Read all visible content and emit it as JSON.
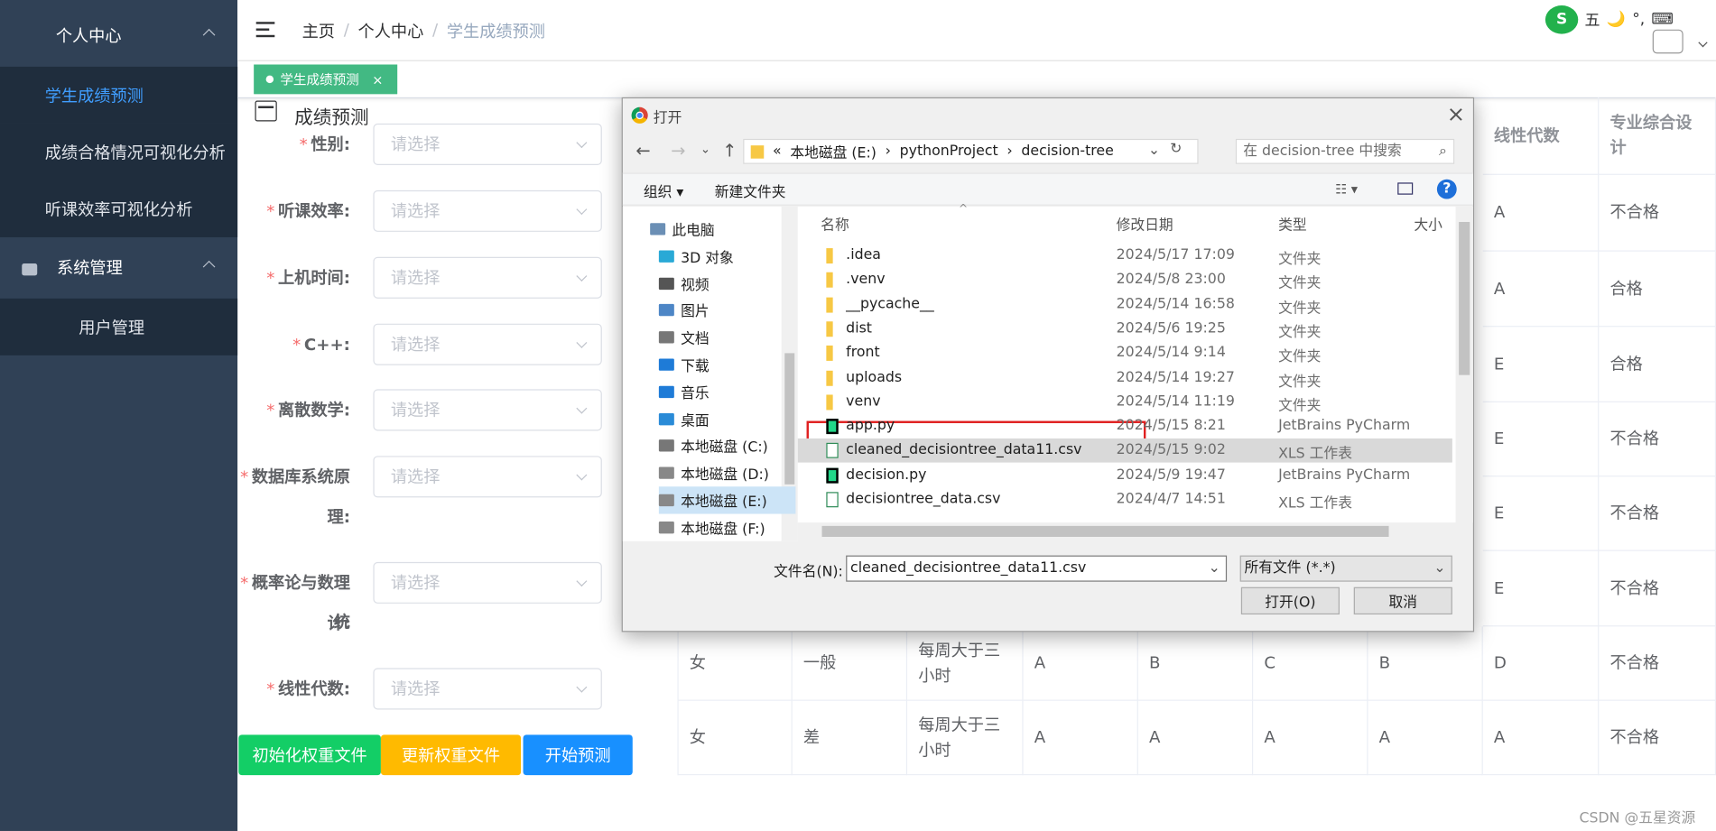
{
  "sidebar": {
    "group1": "个人中心",
    "items": [
      "学生成绩预测",
      "成绩合格情况可视化分析",
      "听课效率可视化分析"
    ],
    "group2": "系统管理",
    "sub": "用户管理"
  },
  "header": {
    "crumbs": [
      "主页",
      "个人中心",
      "学生成绩预测"
    ],
    "tag": "学生成绩预测",
    "tag_close": "×"
  },
  "form": {
    "title": "成绩预测",
    "fields": [
      {
        "l1": "性别:",
        "l2": ""
      },
      {
        "l1": "听课效率:",
        "l2": ""
      },
      {
        "l1": "上机时间:",
        "l2": ""
      },
      {
        "l1": "C++:",
        "l2": ""
      },
      {
        "l1": "离散数学:",
        "l2": ""
      },
      {
        "l1": "数据库系统原",
        "l2": "理:"
      },
      {
        "l1": "概率论与数理统",
        "l2": "计:"
      },
      {
        "l1": "线性代数:",
        "l2": ""
      }
    ],
    "placeholder": "请选择",
    "req": "*",
    "buttons": [
      "初始化权重文件",
      "更新权重文件",
      "开始预测"
    ]
  },
  "table": {
    "headers": [
      "线性代数",
      "专业综合设计"
    ],
    "right_rows": [
      [
        "A",
        "不合格"
      ],
      [
        "A",
        "合格"
      ],
      [
        "E",
        "合格"
      ],
      [
        "E",
        "不合格"
      ],
      [
        "E",
        "不合格"
      ],
      [
        "E",
        "不合格"
      ]
    ],
    "full_rows": [
      [
        "女",
        "一般",
        "每周大于三小时",
        "A",
        "B",
        "C",
        "B",
        "D",
        "不合格"
      ],
      [
        "女",
        "差",
        "每周大于三小时",
        "A",
        "A",
        "A",
        "A",
        "A",
        "不合格"
      ]
    ]
  },
  "dialog": {
    "title": "打开",
    "close": "×",
    "path": [
      "«",
      "本地磁盘 (E:)",
      "›",
      "pythonProject",
      "›",
      "decision-tree"
    ],
    "search_placeholder": "在 decision-tree 中搜索",
    "organize": "组织 ▾",
    "new_folder": "新建文件夹",
    "nav": [
      "此电脑",
      "3D 对象",
      "视频",
      "图片",
      "文档",
      "下载",
      "音乐",
      "桌面",
      "本地磁盘 (C:)",
      "本地磁盘 (D:)",
      "本地磁盘 (E:)",
      "本地磁盘 (F:)"
    ],
    "cols": [
      "名称",
      "修改日期",
      "类型",
      "大小"
    ],
    "files": [
      {
        "name": ".idea",
        "date": "2024/5/17 17:09",
        "type": "文件夹",
        "kind": "folder"
      },
      {
        "name": ".venv",
        "date": "2024/5/8 23:00",
        "type": "文件夹",
        "kind": "folder"
      },
      {
        "name": "__pycache__",
        "date": "2024/5/14 16:58",
        "type": "文件夹",
        "kind": "folder"
      },
      {
        "name": "dist",
        "date": "2024/5/6 19:25",
        "type": "文件夹",
        "kind": "folder"
      },
      {
        "name": "front",
        "date": "2024/5/14 9:14",
        "type": "文件夹",
        "kind": "folder"
      },
      {
        "name": "uploads",
        "date": "2024/5/14 19:27",
        "type": "文件夹",
        "kind": "folder"
      },
      {
        "name": "venv",
        "date": "2024/5/14 11:19",
        "type": "文件夹",
        "kind": "folder"
      },
      {
        "name": "app.py",
        "date": "2024/5/15 8:21",
        "type": "JetBrains PyCharm",
        "kind": "py"
      },
      {
        "name": "cleaned_decisiontree_data11.csv",
        "date": "2024/5/15 9:02",
        "type": "XLS 工作表",
        "kind": "csv"
      },
      {
        "name": "decision.py",
        "date": "2024/5/9 19:47",
        "type": "JetBrains PyCharm",
        "kind": "py"
      },
      {
        "name": "decisiontree_data.csv",
        "date": "2024/4/7 14:51",
        "type": "XLS 工作表",
        "kind": "csv"
      }
    ],
    "filename_label": "文件名(N):",
    "filename": "cleaned_decisiontree_data11.csv",
    "filetype": "所有文件 (*.*)",
    "open": "打开(O)",
    "cancel": "取消"
  },
  "ime": [
    "五",
    "🌙",
    "°,",
    "⌨"
  ],
  "watermark": "CSDN @五星资源"
}
